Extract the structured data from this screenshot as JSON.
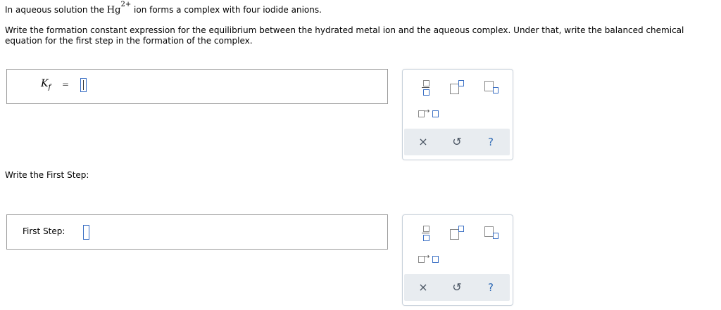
{
  "question": {
    "intro_prefix": "In aqueous solution the ",
    "ion_symbol": "Hg",
    "ion_charge": "2+",
    "intro_suffix": " ion forms a complex with four iodide anions.",
    "instructions": "Write the formation constant expression for the equilibrium between the hydrated metal ion and the aqueous complex. Under that, write the balanced chemical equation for the first step in the formation of the complex.",
    "first_step_heading": "Write the First Step:"
  },
  "kf_input": {
    "symbol": "K",
    "subscript": "f",
    "equals": "="
  },
  "first_step_input": {
    "label": "First Step:"
  },
  "toolbar": {
    "tools": [
      "fraction-icon",
      "superscript-icon",
      "subscript-icon",
      "reaction-arrow-icon"
    ],
    "arrow_glyph": "→",
    "clear_glyph": "×",
    "undo_glyph": "↺",
    "help_glyph": "?"
  },
  "colors": {
    "accent": "#3a6fc4",
    "toolbar_bottom": "#e8ecf0",
    "border": "#9a9a9a"
  }
}
